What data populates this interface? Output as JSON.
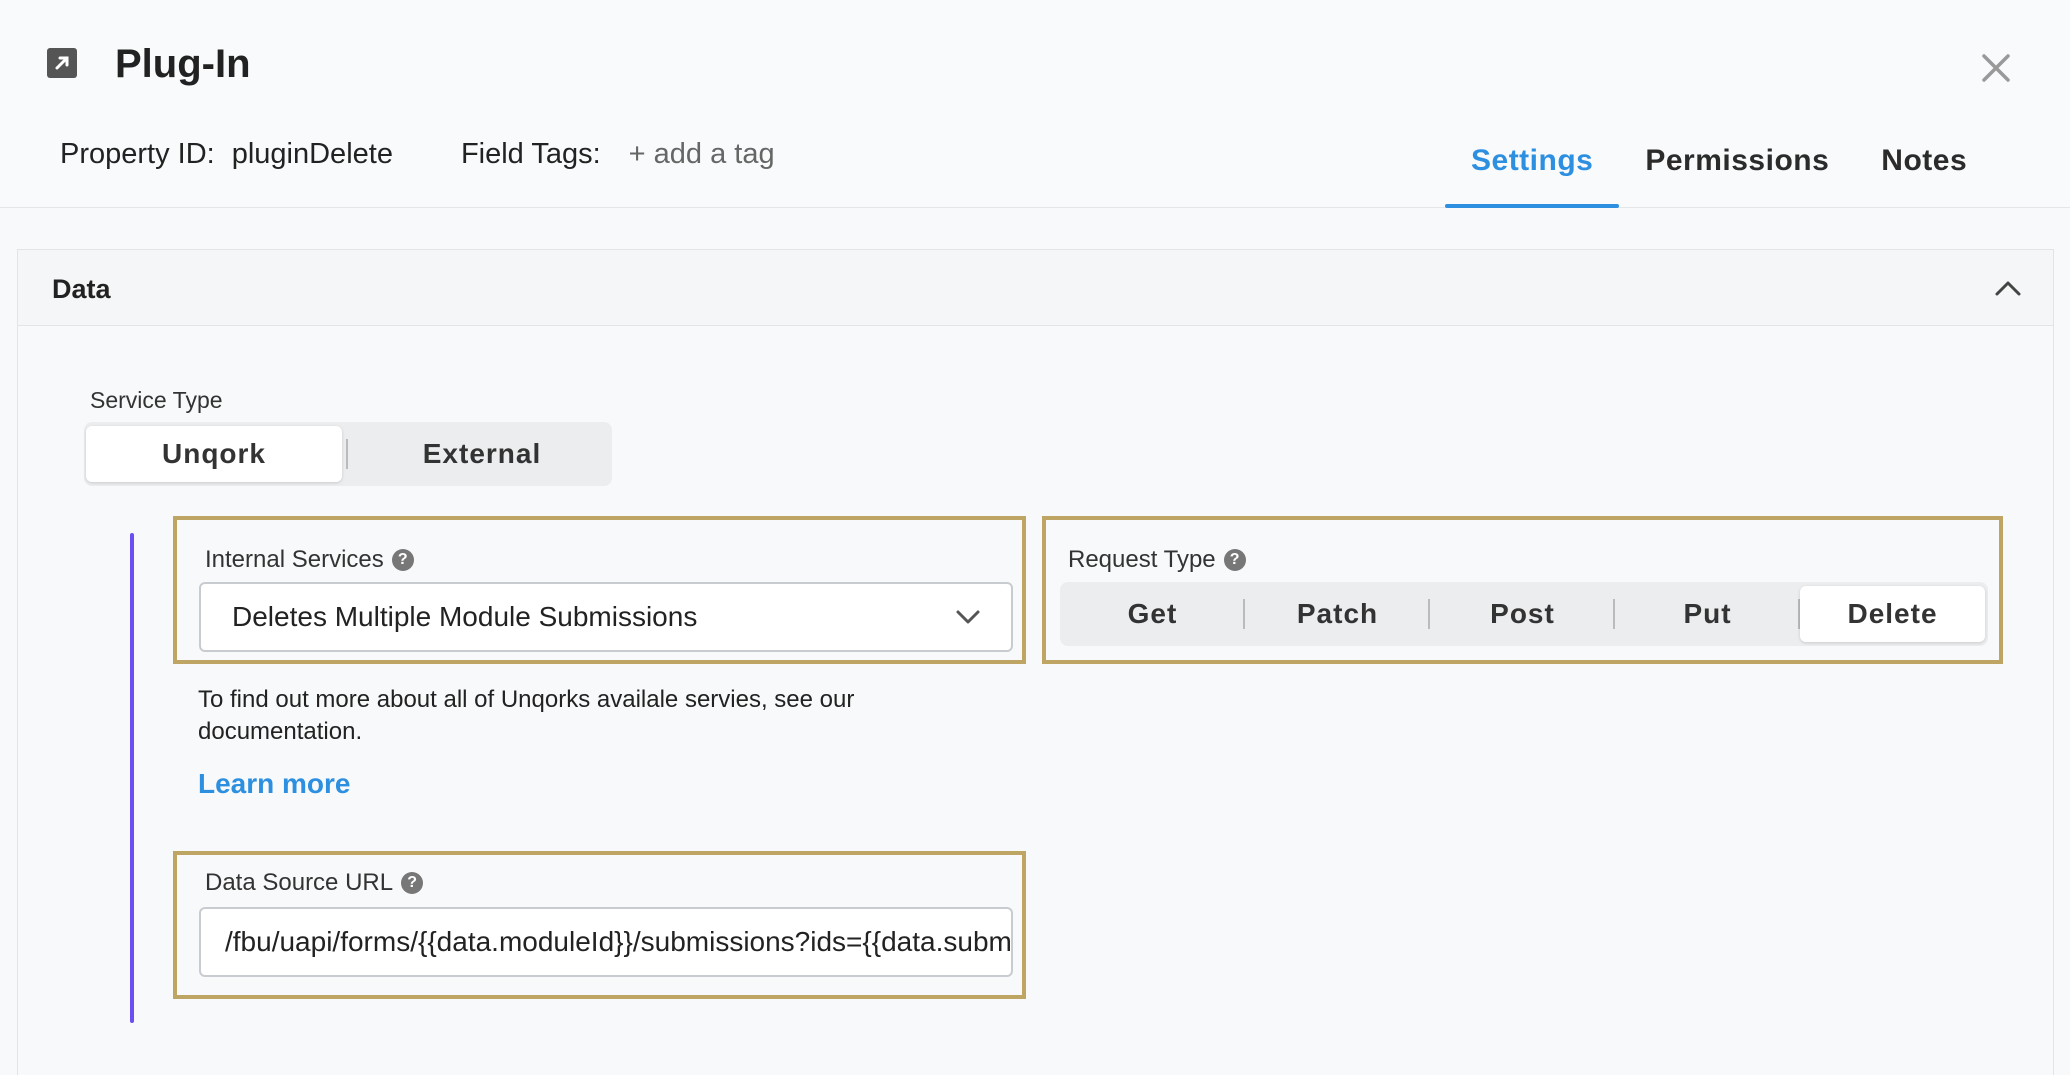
{
  "header": {
    "title": "Plug-In",
    "property_id_label": "Property ID:",
    "property_id_value": "pluginDelete",
    "field_tags_label": "Field Tags:",
    "add_tag_label": "+ add a tag",
    "tabs": [
      {
        "label": "Settings",
        "active": true
      },
      {
        "label": "Permissions",
        "active": false
      },
      {
        "label": "Notes",
        "active": false
      }
    ]
  },
  "section": {
    "title": "Data"
  },
  "service_type": {
    "label": "Service Type",
    "options": [
      "Unqork",
      "External"
    ],
    "selected": "Unqork"
  },
  "internal_services": {
    "label": "Internal Services",
    "value": "Deletes Multiple Module Submissions"
  },
  "request_type": {
    "label": "Request Type",
    "options": [
      "Get",
      "Patch",
      "Post",
      "Put",
      "Delete"
    ],
    "selected": "Delete"
  },
  "description": {
    "text": "To find out more about all of Unqorks availale servies, see our documentation.",
    "link": "Learn more"
  },
  "data_source_url": {
    "label": "Data Source URL",
    "value": "/fbu/uapi/forms/{{data.moduleId}}/submissions?ids={{data.submissionIds}}"
  },
  "colors": {
    "accent": "#2d8fe0",
    "highlight_border": "#bfa563",
    "vertical_line": "#6b4ff0"
  },
  "icons": {
    "title": "external-link-icon",
    "close": "close-icon",
    "collapse": "chevron-up-icon",
    "dropdown": "chevron-down-icon",
    "help": "help-icon"
  }
}
